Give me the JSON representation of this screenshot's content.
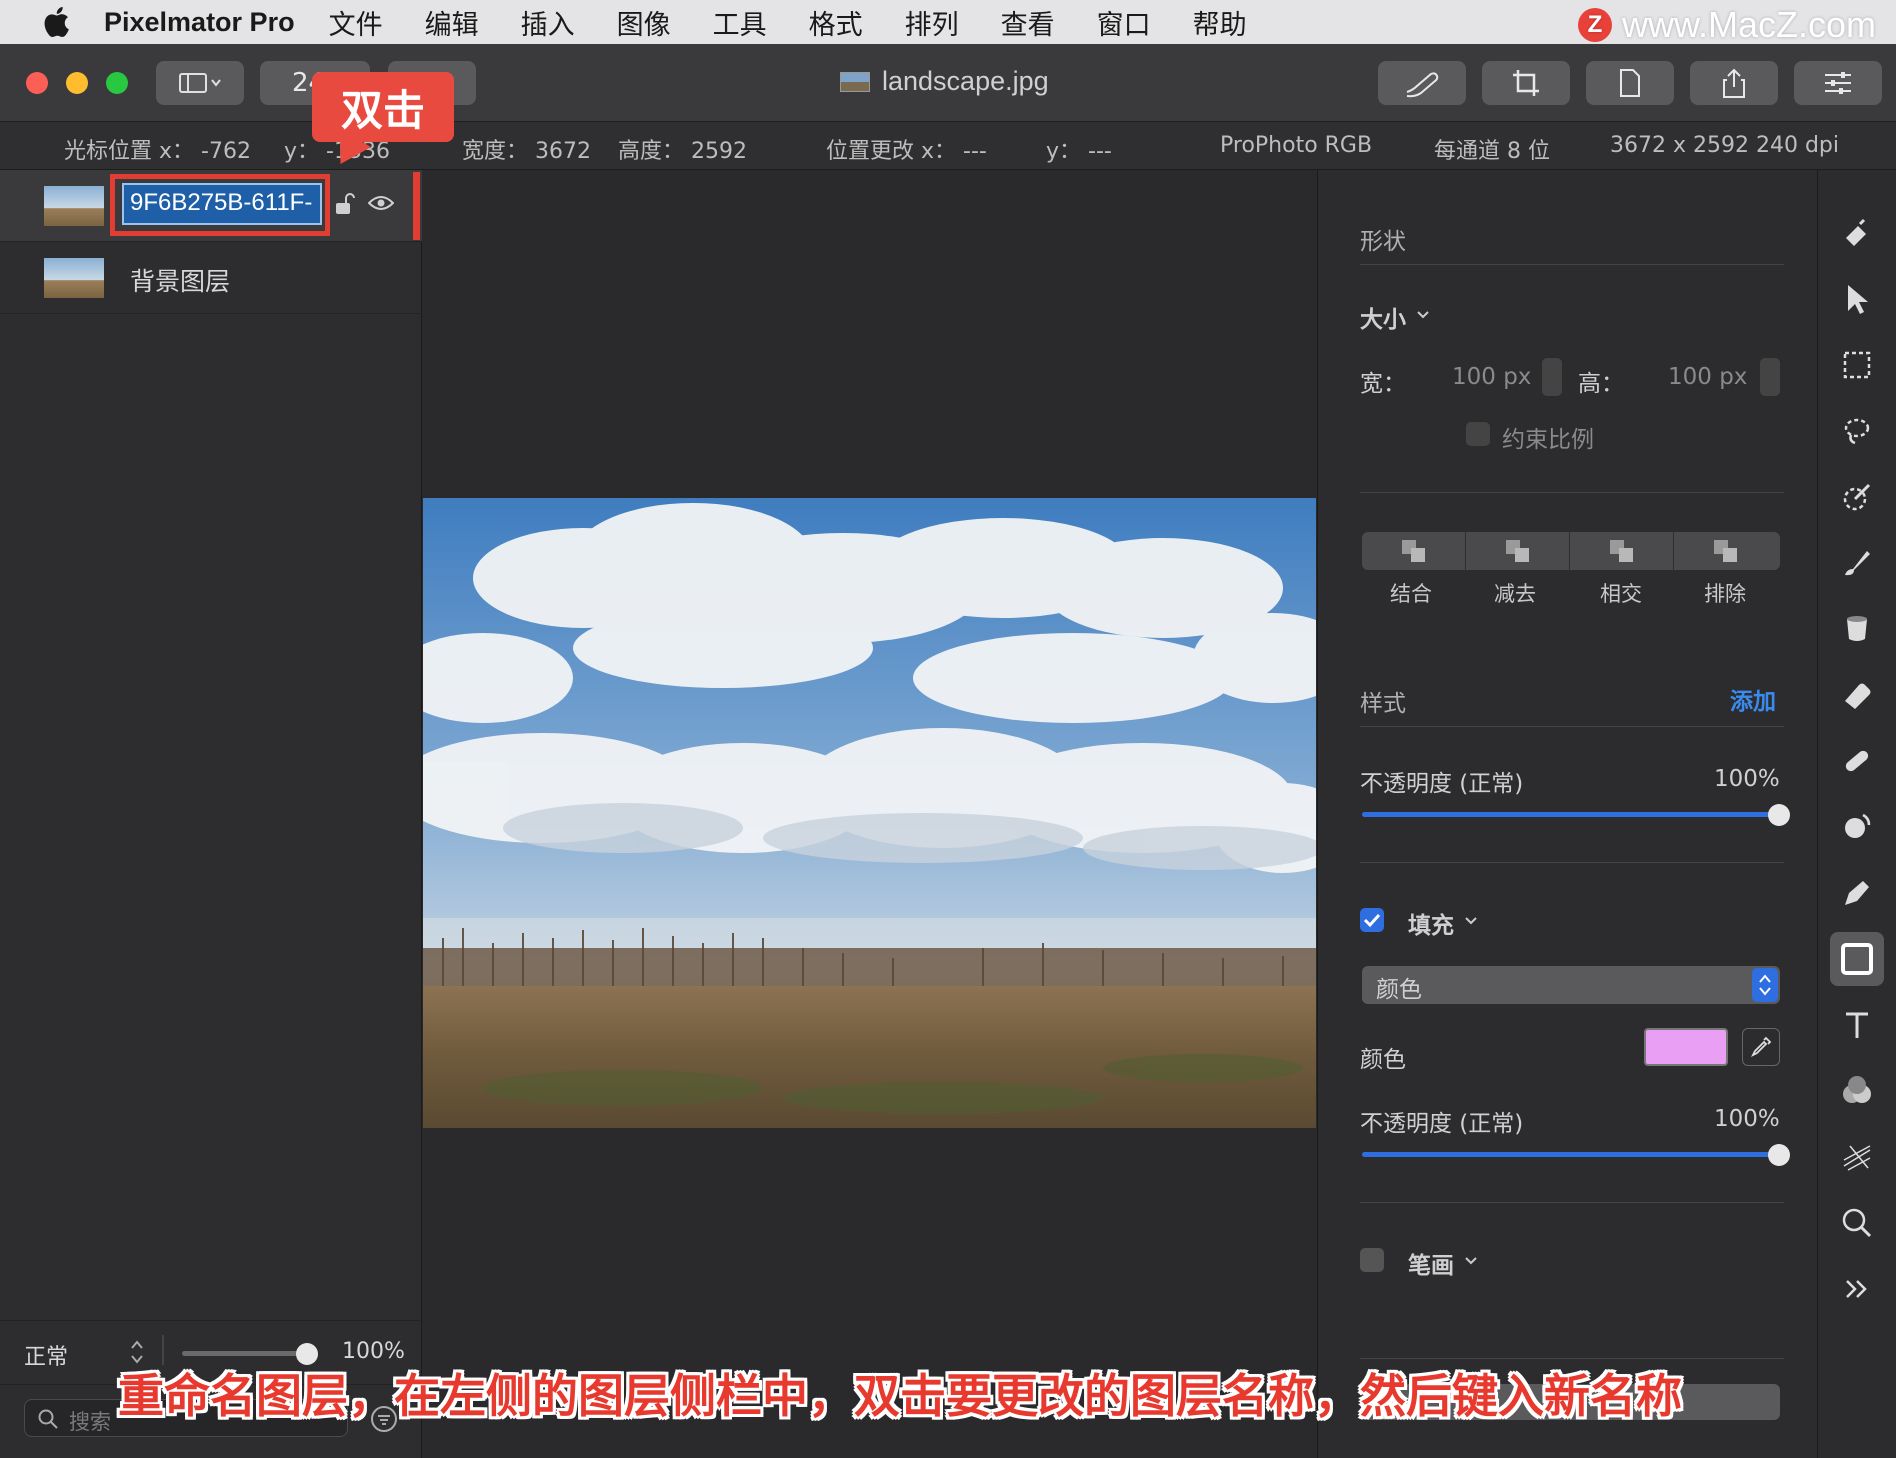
{
  "menubar": {
    "app_name": "Pixelmator Pro",
    "items": [
      "文件",
      "编辑",
      "插入",
      "图像",
      "工具",
      "格式",
      "排列",
      "查看",
      "窗口",
      "帮助"
    ],
    "watermark": "www.MacZ.com",
    "watermark_badge": "Z"
  },
  "titlebar": {
    "zoom_label": "24",
    "document_title": "landscape.jpg",
    "toolbar_icons": [
      "brush-icon",
      "crop-icon",
      "document-icon",
      "share-icon",
      "adjust-icon"
    ]
  },
  "infobar": {
    "cursor_x": "光标位置 x： -762",
    "cursor_y": "y：  -1336",
    "width": "宽度： 3672",
    "height": "高度： 2592",
    "pos_x": "位置更改 x： ---",
    "pos_y": "y： ---",
    "color_profile": "ProPhoto RGB",
    "bit_depth": "每通道 8 位",
    "resolution": "3672 x 2592 240 dpi"
  },
  "layers": {
    "items": [
      {
        "name": "9F6B275B-611F-",
        "editing": true
      },
      {
        "name": "背景图层",
        "editing": false
      }
    ],
    "blend_mode": "正常",
    "opacity": "100%",
    "search_placeholder": "搜索"
  },
  "annotation": {
    "callout": "双击",
    "caption": "重命名图层，在左侧的图层侧栏中，双击要更改的图层名称，然后键入新名称"
  },
  "inspector": {
    "shape_title": "形状",
    "size_label": "大小",
    "width_label": "宽：",
    "width_value": "100 px",
    "height_label": "高：",
    "height_value": "100 px",
    "constrain_label": "约束比例",
    "ops": [
      "结合",
      "减去",
      "相交",
      "排除"
    ],
    "style_title": "样式",
    "add_label": "添加",
    "opacity1_label": "不透明度 (正常)",
    "opacity1_value": "100%",
    "opacity1_level": 1.0,
    "fill_label": "填充",
    "fill_checked": true,
    "fill_type": "颜色",
    "color_label": "颜色",
    "fill_color": "#e9a0f4",
    "opacity2_label": "不透明度 (正常)",
    "opacity2_value": "100%",
    "opacity2_level": 1.0,
    "stroke_label": "笔画",
    "stroke_checked": false
  },
  "tools": [
    "paint-bucket-icon",
    "pointer-icon",
    "rect-select-icon",
    "lasso-icon",
    "magic-select-icon",
    "brush-icon",
    "fill-icon",
    "eraser-icon",
    "bandage-icon",
    "clone-icon",
    "pen-icon",
    "shape-icon",
    "type-icon",
    "color-adjust-icon",
    "distort-icon",
    "zoom-icon",
    "more-icon"
  ],
  "colors": {
    "accent": "#2e6ee0",
    "annotation_red": "#e23d33"
  }
}
